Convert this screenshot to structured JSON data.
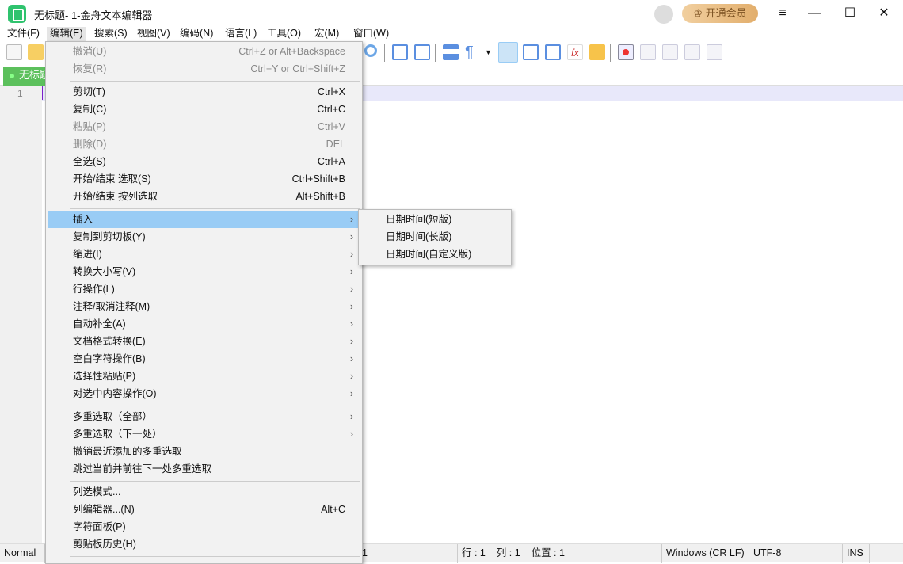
{
  "window": {
    "title": "无标题- 1-金舟文本编辑器",
    "vip_label": "开通会员"
  },
  "menubar": [
    "文件(F)",
    "编辑(E)",
    "搜索(S)",
    "视图(V)",
    "编码(N)",
    "语言(L)",
    "工具(O)",
    "宏(M)",
    "窗口(W)"
  ],
  "tab": {
    "label": "无标题"
  },
  "editor": {
    "line_number": "1"
  },
  "edit_menu": [
    {
      "label": "撤消(U)",
      "shortcut": "Ctrl+Z or Alt+Backspace",
      "disabled": true
    },
    {
      "label": "恢复(R)",
      "shortcut": "Ctrl+Y or Ctrl+Shift+Z",
      "disabled": true
    },
    {
      "label": "剪切(T)",
      "shortcut": "Ctrl+X"
    },
    {
      "label": "复制(C)",
      "shortcut": "Ctrl+C"
    },
    {
      "label": "粘贴(P)",
      "shortcut": "Ctrl+V",
      "disabled": true
    },
    {
      "label": "删除(D)",
      "shortcut": "DEL",
      "disabled": true
    },
    {
      "label": "全选(S)",
      "shortcut": "Ctrl+A"
    },
    {
      "label": "开始/结束 选取(S)",
      "shortcut": "Ctrl+Shift+B"
    },
    {
      "label": "开始/结束 按列选取",
      "shortcut": "Alt+Shift+B"
    },
    {
      "label": "插入",
      "submenu": true,
      "highlighted": true
    },
    {
      "label": "复制到剪切板(Y)",
      "submenu": true
    },
    {
      "label": "缩进(I)",
      "submenu": true
    },
    {
      "label": "转换大小写(V)",
      "submenu": true
    },
    {
      "label": "行操作(L)",
      "submenu": true
    },
    {
      "label": "注释/取消注释(M)",
      "submenu": true
    },
    {
      "label": "自动补全(A)",
      "submenu": true
    },
    {
      "label": "文档格式转换(E)",
      "submenu": true
    },
    {
      "label": "空白字符操作(B)",
      "submenu": true
    },
    {
      "label": "选择性粘贴(P)",
      "submenu": true
    },
    {
      "label": "对选中内容操作(O)",
      "submenu": true
    },
    {
      "label": "多重选取（全部）",
      "submenu": true
    },
    {
      "label": "多重选取（下一处）",
      "submenu": true
    },
    {
      "label": "撤销最近添加的多重选取"
    },
    {
      "label": "跳过当前并前往下一处多重选取"
    },
    {
      "label": "列选模式..."
    },
    {
      "label": "列编辑器...(N)",
      "shortcut": "Alt+C"
    },
    {
      "label": "字符面板(P)"
    },
    {
      "label": "剪贴板历史(H)"
    }
  ],
  "insert_submenu": [
    "日期时间(短版)",
    "日期时间(长版)",
    "日期时间(自定义版)"
  ],
  "statusbar": {
    "mode": "Normal",
    "length": "1",
    "row": "行 : 1",
    "col": "列 : 1",
    "pos": "位置 : 1",
    "eol": "Windows (CR LF)",
    "encoding": "UTF-8",
    "ins": "INS"
  }
}
